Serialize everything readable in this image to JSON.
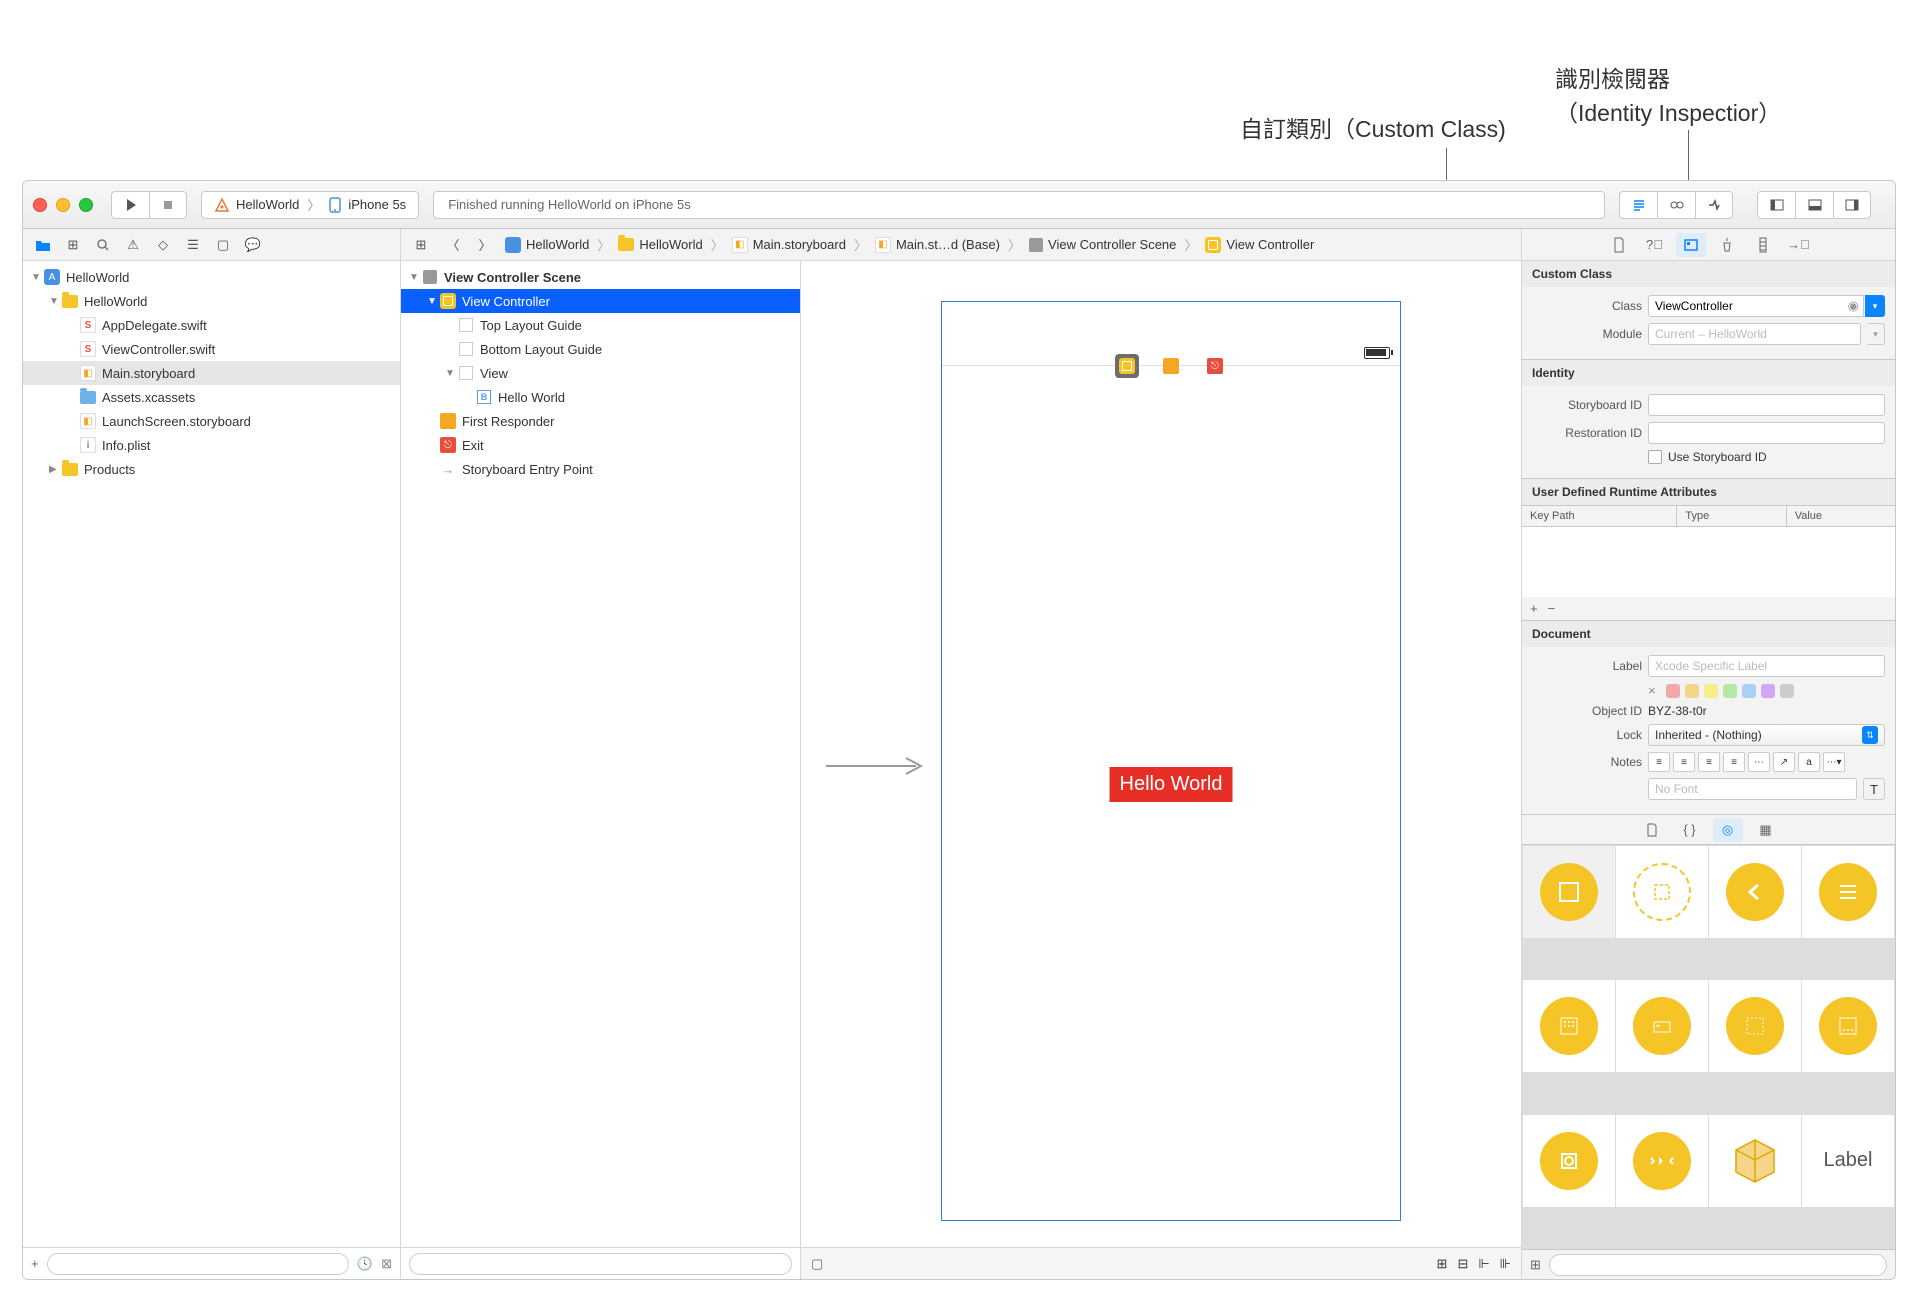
{
  "annotations": {
    "custom_class": "自訂類別（Custom Class)",
    "identity_inspector_line1": "識別檢閱器",
    "identity_inspector_line2": "（Identity Inspectior）"
  },
  "toolbar": {
    "scheme_app": "HelloWorld",
    "scheme_device": "iPhone 5s",
    "status_message": "Finished running HelloWorld on iPhone 5s"
  },
  "breadcrumbs": [
    "HelloWorld",
    "HelloWorld",
    "Main.storyboard",
    "Main.st…d (Base)",
    "View Controller Scene",
    "View Controller"
  ],
  "navigator": {
    "items": [
      {
        "name": "HelloWorld",
        "type": "project",
        "depth": 0,
        "expanded": true
      },
      {
        "name": "HelloWorld",
        "type": "folder",
        "depth": 1,
        "expanded": true
      },
      {
        "name": "AppDelegate.swift",
        "type": "swift",
        "depth": 2
      },
      {
        "name": "ViewController.swift",
        "type": "swift",
        "depth": 2
      },
      {
        "name": "Main.storyboard",
        "type": "storyboard",
        "depth": 2,
        "selected": true
      },
      {
        "name": "Assets.xcassets",
        "type": "assets",
        "depth": 2
      },
      {
        "name": "LaunchScreen.storyboard",
        "type": "storyboard",
        "depth": 2
      },
      {
        "name": "Info.plist",
        "type": "plist",
        "depth": 2
      },
      {
        "name": "Products",
        "type": "folder",
        "depth": 1,
        "expanded": false
      }
    ]
  },
  "outline": {
    "items": [
      {
        "name": "View Controller Scene",
        "type": "scene",
        "depth": 0,
        "expanded": true,
        "heading": true
      },
      {
        "name": "View Controller",
        "type": "vc",
        "depth": 1,
        "expanded": true,
        "selected": true
      },
      {
        "name": "Top Layout Guide",
        "type": "guide",
        "depth": 2
      },
      {
        "name": "Bottom Layout Guide",
        "type": "guide",
        "depth": 2
      },
      {
        "name": "View",
        "type": "view",
        "depth": 2,
        "expanded": true
      },
      {
        "name": "Hello World",
        "type": "label",
        "depth": 3
      },
      {
        "name": "First Responder",
        "type": "responder",
        "depth": 1
      },
      {
        "name": "Exit",
        "type": "exit",
        "depth": 1
      },
      {
        "name": "Storyboard Entry Point",
        "type": "entry",
        "depth": 1
      }
    ]
  },
  "canvas": {
    "label_text": "Hello World"
  },
  "inspector": {
    "custom_class": {
      "title": "Custom Class",
      "class_label": "Class",
      "class_value": "ViewController",
      "module_label": "Module",
      "module_placeholder": "Current – HelloWorld"
    },
    "identity": {
      "title": "Identity",
      "storyboard_id_label": "Storyboard ID",
      "restoration_id_label": "Restoration ID",
      "use_storyboard_id_label": "Use Storyboard ID"
    },
    "user_defined": {
      "title": "User Defined Runtime Attributes",
      "col_keypath": "Key Path",
      "col_type": "Type",
      "col_value": "Value"
    },
    "document": {
      "title": "Document",
      "label_label": "Label",
      "label_placeholder": "Xcode Specific Label",
      "object_id_label": "Object ID",
      "object_id_value": "BYZ-38-t0r",
      "lock_label": "Lock",
      "lock_value": "Inherited - (Nothing)",
      "notes_label": "Notes",
      "no_font": "No Font"
    },
    "library_label": "Label"
  }
}
